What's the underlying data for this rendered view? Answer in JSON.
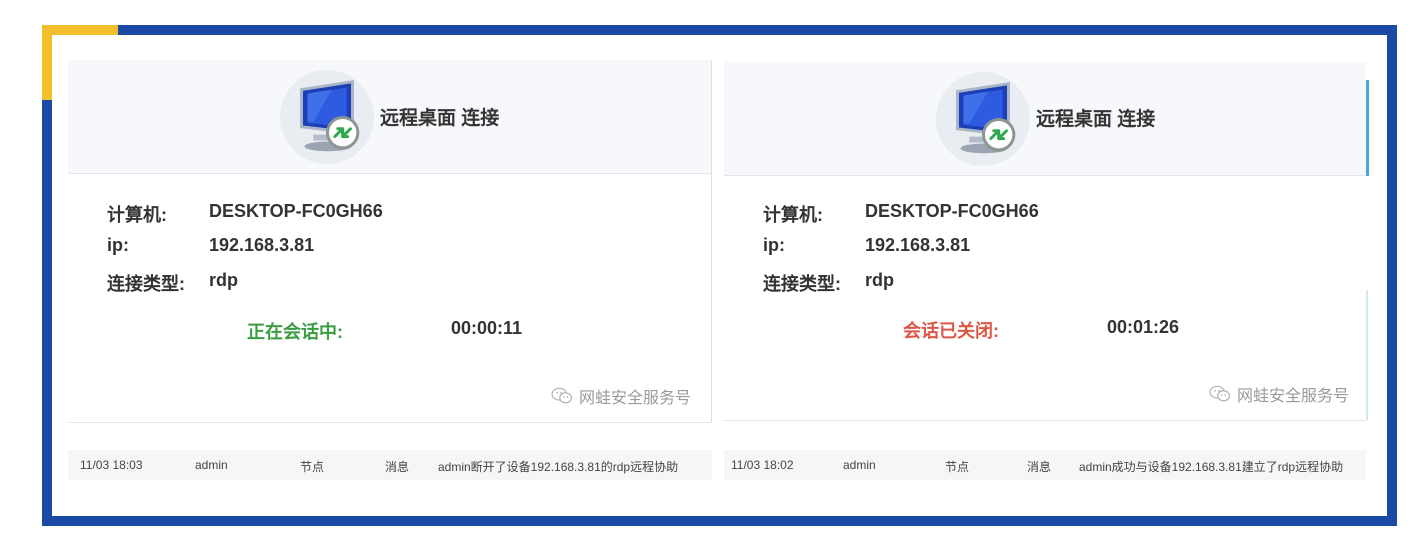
{
  "panels": [
    {
      "title": "远程桌面 连接",
      "fields": [
        {
          "label": "计算机:",
          "value": "DESKTOP-FC0GH66"
        },
        {
          "label": "ip:",
          "value": "192.168.3.81"
        },
        {
          "label": "连接类型:",
          "value": "rdp"
        }
      ],
      "status": {
        "label": "正在会话中:",
        "time": "00:00:11",
        "color": "#3b9c43"
      },
      "watermark": "网蛙安全服务号",
      "log": {
        "time": "11/03 18:03",
        "user": "admin",
        "node": "节点",
        "type": "消息",
        "message": "admin断开了设备192.168.3.81的rdp远程协助"
      }
    },
    {
      "title": "远程桌面 连接",
      "fields": [
        {
          "label": "计算机:",
          "value": "DESKTOP-FC0GH66"
        },
        {
          "label": "ip:",
          "value": "192.168.3.81"
        },
        {
          "label": "连接类型:",
          "value": "rdp"
        }
      ],
      "status": {
        "label": "会话已关闭:",
        "time": "00:01:26",
        "color": "#dc5646"
      },
      "watermark": "网蛙安全服务号",
      "log": {
        "time": "11/03 18:02",
        "user": "admin",
        "node": "节点",
        "type": "消息",
        "message": "admin成功与设备192.168.3.81建立了rdp远程协助"
      }
    }
  ],
  "colors": {
    "frame": "#1a4aa3",
    "accent": "#f2bf2c"
  },
  "icons": [
    "remote-desktop-icon",
    "wechat-icon"
  ]
}
